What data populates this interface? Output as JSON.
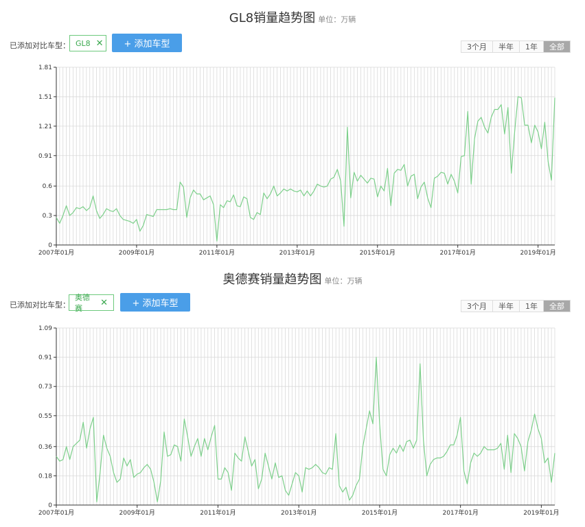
{
  "controls": {
    "added_label": "已添加对比车型：",
    "add_button": "+ 添加车型",
    "ranges": [
      "3个月",
      "半年",
      "1年",
      "全部"
    ],
    "active_range": "全部"
  },
  "charts": [
    {
      "title": "GL8销量趋势图",
      "unit": "单位：万辆",
      "chip": "GL8"
    },
    {
      "title": "奥德赛销量趋势图",
      "unit": "单位：万辆",
      "chip": "奥德赛"
    }
  ],
  "chart_data": [
    {
      "type": "line",
      "title": "GL8销量趋势图",
      "x_ticks": [
        "2007年01月",
        "2009年01月",
        "2011年01月",
        "2013年01月",
        "2015年01月",
        "2017年01月",
        "2019年01月"
      ],
      "y_ticks": [
        "0",
        "0.3",
        "0.6",
        "0.91",
        "1.21",
        "1.51",
        "1.81"
      ],
      "ylim": [
        0,
        1.81
      ],
      "x_start": "2007-01",
      "grid": true,
      "color": "#7ccf8a",
      "series": [
        {
          "name": "GL8",
          "values": [
            0.28,
            0.22,
            0.3,
            0.4,
            0.3,
            0.33,
            0.38,
            0.37,
            0.39,
            0.35,
            0.38,
            0.5,
            0.35,
            0.27,
            0.31,
            0.37,
            0.35,
            0.34,
            0.37,
            0.3,
            0.26,
            0.25,
            0.24,
            0.22,
            0.26,
            0.14,
            0.2,
            0.31,
            0.3,
            0.29,
            0.36,
            0.36,
            0.36,
            0.36,
            0.37,
            0.36,
            0.36,
            0.64,
            0.59,
            0.28,
            0.48,
            0.56,
            0.52,
            0.52,
            0.46,
            0.48,
            0.5,
            0.41,
            0.04,
            0.41,
            0.38,
            0.45,
            0.44,
            0.51,
            0.4,
            0.39,
            0.49,
            0.47,
            0.28,
            0.26,
            0.33,
            0.31,
            0.53,
            0.47,
            0.52,
            0.6,
            0.5,
            0.53,
            0.57,
            0.55,
            0.57,
            0.55,
            0.54,
            0.56,
            0.5,
            0.55,
            0.5,
            0.55,
            0.62,
            0.6,
            0.59,
            0.6,
            0.67,
            0.69,
            0.77,
            0.65,
            0.19,
            1.2,
            0.48,
            0.74,
            0.65,
            0.71,
            0.67,
            0.63,
            0.68,
            0.67,
            0.49,
            0.6,
            0.55,
            0.78,
            0.4,
            0.73,
            0.77,
            0.76,
            0.82,
            0.6,
            0.7,
            0.72,
            0.47,
            0.59,
            0.64,
            0.48,
            0.38,
            0.68,
            0.7,
            0.74,
            0.73,
            0.62,
            0.72,
            0.65,
            0.53,
            0.9,
            0.91,
            1.36,
            0.62,
            1.08,
            1.26,
            1.3,
            1.2,
            1.14,
            1.3,
            1.38,
            1.38,
            1.43,
            1.13,
            1.4,
            0.73,
            1.15,
            1.51,
            1.5,
            1.22,
            1.22,
            1.04,
            1.22,
            1.15,
            0.98,
            1.25,
            0.85,
            0.66,
            1.5
          ]
        }
      ]
    },
    {
      "type": "line",
      "title": "奥德赛销量趋势图",
      "x_ticks": [
        "2007年01月",
        "2009年01月",
        "2011年01月",
        "2013年01月",
        "2015年01月",
        "2017年01月",
        "2019年01月"
      ],
      "y_ticks": [
        "0",
        "0.18",
        "0.36",
        "0.55",
        "0.73",
        "0.91",
        "1.09"
      ],
      "ylim": [
        0,
        1.09
      ],
      "x_start": "2007-01",
      "grid": true,
      "color": "#7ccf8a",
      "series": [
        {
          "name": "奥德赛",
          "values": [
            0.3,
            0.27,
            0.28,
            0.36,
            0.28,
            0.36,
            0.38,
            0.4,
            0.51,
            0.35,
            0.47,
            0.54,
            0.02,
            0.2,
            0.43,
            0.35,
            0.3,
            0.2,
            0.14,
            0.16,
            0.29,
            0.24,
            0.28,
            0.17,
            0.19,
            0.2,
            0.23,
            0.25,
            0.22,
            0.14,
            0.02,
            0.15,
            0.45,
            0.3,
            0.31,
            0.37,
            0.36,
            0.27,
            0.53,
            0.42,
            0.3,
            0.36,
            0.41,
            0.3,
            0.41,
            0.34,
            0.42,
            0.49,
            0.16,
            0.16,
            0.23,
            0.2,
            0.09,
            0.32,
            0.29,
            0.27,
            0.42,
            0.33,
            0.24,
            0.28,
            0.1,
            0.16,
            0.32,
            0.24,
            0.16,
            0.26,
            0.17,
            0.18,
            0.09,
            0.06,
            0.13,
            0.2,
            0.18,
            0.08,
            0.23,
            0.22,
            0.23,
            0.25,
            0.23,
            0.2,
            0.19,
            0.23,
            0.22,
            0.44,
            0.12,
            0.08,
            0.11,
            0.03,
            0.06,
            0.12,
            0.16,
            0.36,
            0.47,
            0.58,
            0.5,
            0.91,
            0.5,
            0.22,
            0.18,
            0.31,
            0.35,
            0.32,
            0.37,
            0.33,
            0.39,
            0.4,
            0.35,
            0.4,
            0.87,
            0.4,
            0.18,
            0.25,
            0.28,
            0.29,
            0.29,
            0.3,
            0.33,
            0.37,
            0.37,
            0.43,
            0.54,
            0.21,
            0.13,
            0.26,
            0.32,
            0.3,
            0.32,
            0.36,
            0.34,
            0.34,
            0.34,
            0.35,
            0.38,
            0.22,
            0.43,
            0.2,
            0.44,
            0.41,
            0.36,
            0.21,
            0.39,
            0.46,
            0.56,
            0.47,
            0.41,
            0.26,
            0.29,
            0.14,
            0.32
          ]
        }
      ]
    }
  ]
}
